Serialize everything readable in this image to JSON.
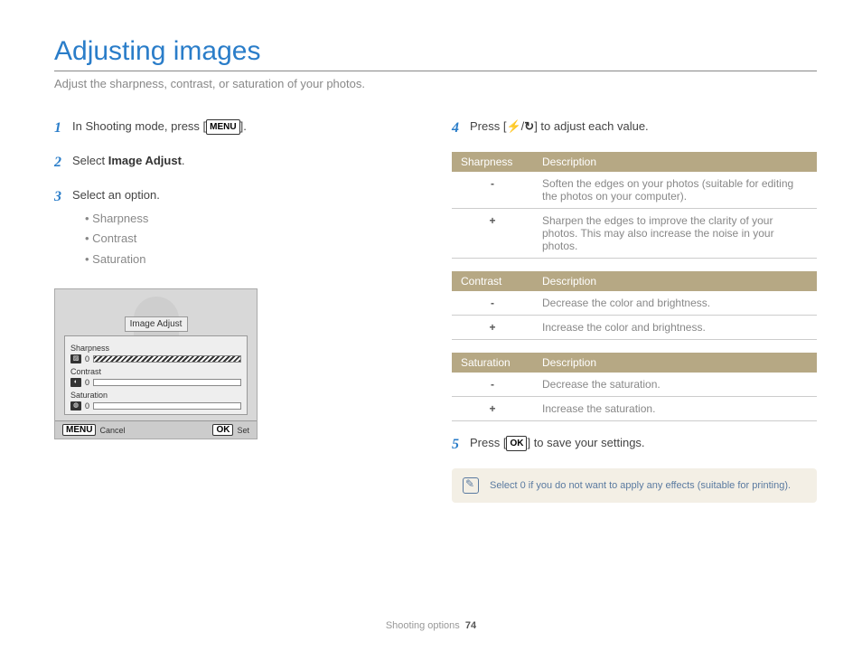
{
  "title": "Adjusting images",
  "subtitle": "Adjust the sharpness, contrast, or saturation of your photos.",
  "steps": {
    "s1a": "In Shooting mode, press [",
    "s1b": "].",
    "menu_badge": "MENU",
    "s2a": "Select ",
    "s2bold": "Image Adjust",
    "s2b": ".",
    "s3": "Select an option.",
    "s3_opts": [
      "Sharpness",
      "Contrast",
      "Saturation"
    ],
    "s4a": "Press [",
    "s4mid": "/",
    "s4b": "] to adjust each value.",
    "s5a": "Press [",
    "s5b": "] to save your settings.",
    "ok_badge": "OK"
  },
  "mock": {
    "title": "Image Adjust",
    "rows": {
      "sharpness": "Sharpness",
      "contrast": "Contrast",
      "saturation": "Saturation",
      "zero": "0"
    },
    "footer": {
      "menu": "MENU",
      "cancel": "Cancel",
      "ok": "OK",
      "set": "Set"
    }
  },
  "tables": {
    "sharpness": {
      "h1": "Sharpness",
      "h2": "Description",
      "r1": "Soften the edges on your photos (suitable for editing the photos on your computer).",
      "r2": "Sharpen the edges to improve the clarity of your photos. This may also increase the noise in your photos."
    },
    "contrast": {
      "h1": "Contrast",
      "h2": "Description",
      "r1": "Decrease the color and brightness.",
      "r2": "Increase the color and brightness."
    },
    "saturation": {
      "h1": "Saturation",
      "h2": "Description",
      "r1": "Decrease the saturation.",
      "r2": "Increase the saturation."
    },
    "minus": "-",
    "plus": "+"
  },
  "note": "Select 0 if you do not want to apply any effects (suitable for printing).",
  "footer": {
    "section": "Shooting options",
    "page": "74"
  }
}
